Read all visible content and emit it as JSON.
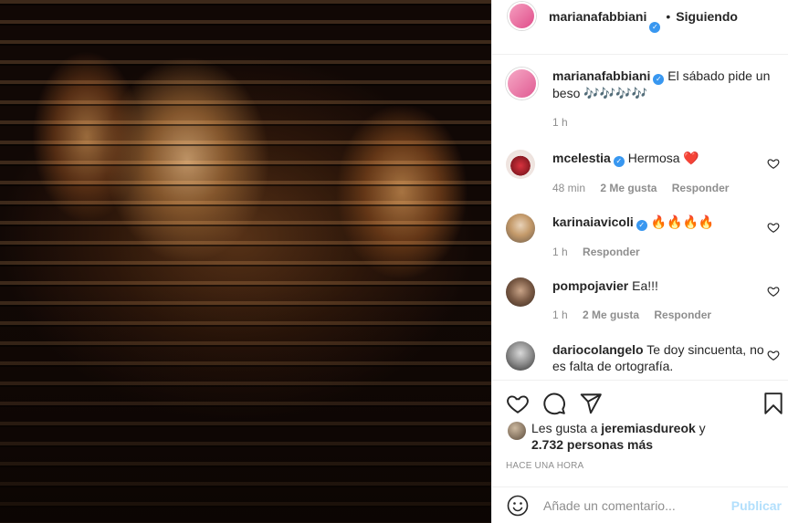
{
  "post": {
    "author": "marianafabbiani",
    "follow_status": "Siguiendo",
    "caption": "El sábado pide un beso",
    "caption_emoji": "🎶🎶🎶🎶",
    "caption_time": "1 h"
  },
  "comments": [
    {
      "user": "mcelestia",
      "text": "Hermosa",
      "emoji": "❤️",
      "time": "48 min",
      "likes": "2 Me gusta",
      "reply": "Responder"
    },
    {
      "user": "karinaiavicoli",
      "text": "",
      "emoji": "🔥🔥🔥🔥",
      "time": "1 h",
      "likes": "",
      "reply": "Responder"
    },
    {
      "user": "pompojavier",
      "text": "Ea!!!",
      "emoji": "",
      "time": "1 h",
      "likes": "2 Me gusta",
      "reply": "Responder"
    },
    {
      "user": "dariocolangelo",
      "text": "Te doy sincuenta, no es falta de ortografía.",
      "emoji": "",
      "time": "",
      "likes": "",
      "reply": ""
    }
  ],
  "likes": {
    "prefix": "Les gusta a",
    "user": "jeremiasdureok",
    "connector": "y",
    "count": "2.732 personas más"
  },
  "timestamp": "HACE UNA HORA",
  "composer": {
    "placeholder": "Añade un comentario...",
    "post_label": "Publicar"
  },
  "icons": {
    "like": "heart-icon",
    "comment": "comment-icon",
    "share": "paper-plane-icon",
    "save": "bookmark-icon",
    "emoji": "smiley-icon"
  },
  "colors": {
    "verified": "#3897f0",
    "heart_red": "#ed4956",
    "post_button_disabled": "#b2dffc",
    "muted": "#8e8e8e"
  }
}
